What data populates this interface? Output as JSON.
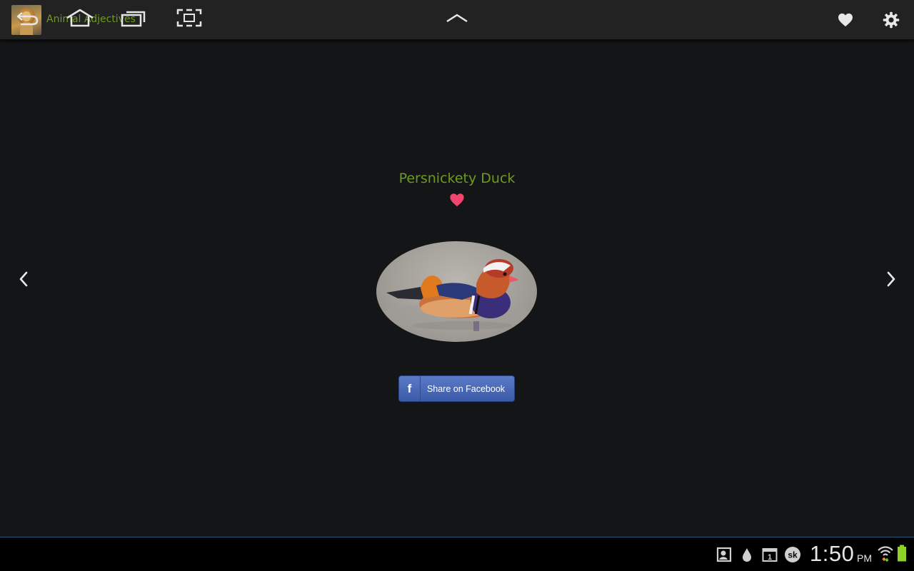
{
  "app": {
    "title": "Animal Adjectives",
    "icon": "lion-app-icon"
  },
  "actionbar": {
    "favorites_icon": "heart-icon",
    "settings_icon": "gear-icon"
  },
  "card": {
    "animal_name": "Persnickety Duck",
    "favorite_icon": "heart-icon",
    "favorited": true,
    "image": "mandarin-duck-photo"
  },
  "navigation": {
    "previous_icon": "chevron-left-icon",
    "next_icon": "chevron-right-icon"
  },
  "share": {
    "logo": "f",
    "label": "Share on Facebook"
  },
  "status_bar": {
    "time": "1:50",
    "ampm": "PM",
    "notification_icons": [
      "gallery-icon",
      "drop-icon",
      "calendar-icon",
      "sk-icon"
    ],
    "calendar_day": "1",
    "sk_label": "sk"
  },
  "colors": {
    "accent_green": "#6f9a1f",
    "favorite_pink": "#f2456e",
    "facebook_blue": "#3b5ba8",
    "background": "#141517",
    "actionbar": "#222222"
  }
}
